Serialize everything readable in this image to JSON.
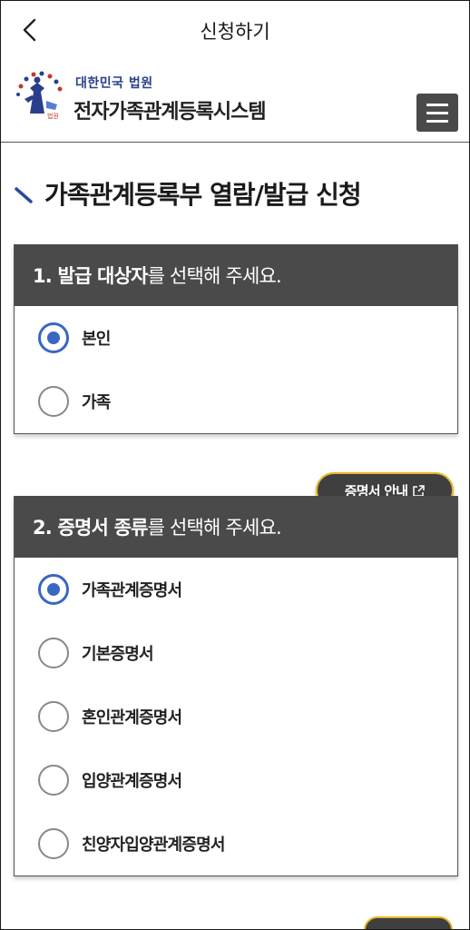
{
  "topbar": {
    "title": "신청하기",
    "back_icon": "chevron-left-icon"
  },
  "header": {
    "court_name": "대한민국 법원",
    "system_name": "전자가족관계등록시스템",
    "menu_icon": "hamburger-icon",
    "emblem_icon": "court-emblem-logo"
  },
  "page": {
    "title": "가족관계등록부 열람/발급 신청"
  },
  "section1": {
    "heading_bold": "1. 발급 대상자",
    "heading_rest": "를 선택해 주세요.",
    "options": [
      {
        "label": "본인",
        "selected": true
      },
      {
        "label": "가족",
        "selected": false
      }
    ]
  },
  "guide_button": {
    "label": "증명서 안내",
    "icon": "external-link-icon"
  },
  "section2": {
    "heading_bold": "2. 증명서 종류",
    "heading_rest": "를 선택해 주세요.",
    "options": [
      {
        "label": "가족관계증명서",
        "selected": true
      },
      {
        "label": "기본증명서",
        "selected": false
      },
      {
        "label": "혼인관계증명서",
        "selected": false
      },
      {
        "label": "입양관계증명서",
        "selected": false
      },
      {
        "label": "친양자입양관계증명서",
        "selected": false
      }
    ]
  },
  "colors": {
    "accent": "#3a66c4",
    "header_bg": "#4a4a4a",
    "highlight": "#e6b627"
  }
}
